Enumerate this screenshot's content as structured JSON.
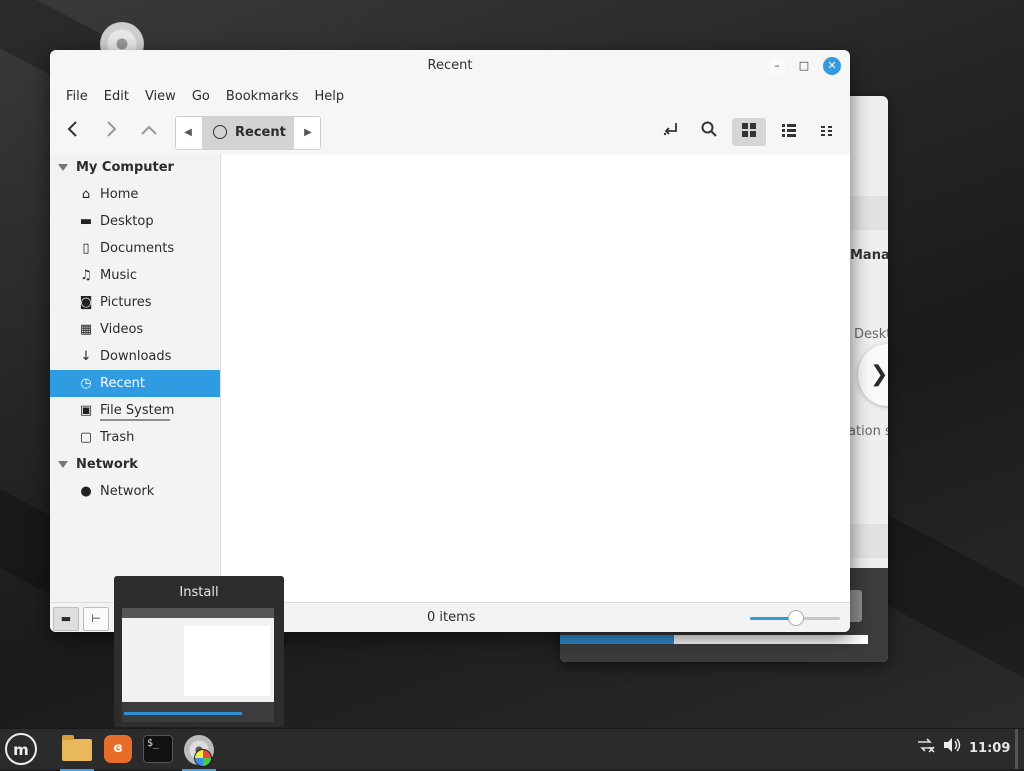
{
  "window": {
    "title": "Recent",
    "controls": {
      "minimize": "–",
      "maximize": "□",
      "close": "✕"
    }
  },
  "menubar": [
    "File",
    "Edit",
    "View",
    "Go",
    "Bookmarks",
    "Help"
  ],
  "toolbar": {
    "back_icon": "back-arrow-icon",
    "forward_icon": "forward-arrow-icon",
    "up_icon": "up-arrow-icon",
    "path_current": "Recent",
    "path_icon": "clock-icon",
    "view_mode_selected": "icon-view"
  },
  "sidebar": {
    "sections": [
      {
        "title": "My Computer",
        "items": [
          {
            "label": "Home",
            "icon": "home-icon",
            "glyph": "⌂"
          },
          {
            "label": "Desktop",
            "icon": "desktop-icon",
            "glyph": "▬"
          },
          {
            "label": "Documents",
            "icon": "document-icon",
            "glyph": "▯"
          },
          {
            "label": "Music",
            "icon": "music-icon",
            "glyph": "♫"
          },
          {
            "label": "Pictures",
            "icon": "camera-icon",
            "glyph": "◙"
          },
          {
            "label": "Videos",
            "icon": "film-icon",
            "glyph": "▦"
          },
          {
            "label": "Downloads",
            "icon": "download-icon",
            "glyph": "↓"
          },
          {
            "label": "Recent",
            "icon": "clock-icon",
            "glyph": "◷",
            "active": true
          },
          {
            "label": "File System",
            "icon": "drive-icon",
            "glyph": "▣"
          },
          {
            "label": "Trash",
            "icon": "trash-icon",
            "glyph": "▢"
          }
        ]
      },
      {
        "title": "Network",
        "items": [
          {
            "label": "Network",
            "icon": "globe-icon",
            "glyph": "●"
          }
        ]
      }
    ]
  },
  "statusbar": {
    "items_count": "0 items",
    "zoom_fraction": 0.5
  },
  "background_window": {
    "visible_text": [
      "Manag",
      "Deskto",
      "ation so"
    ],
    "progress_fraction": 0.37
  },
  "preview": {
    "title": "Install"
  },
  "taskbar": {
    "apps": [
      "menu-icon",
      "file-manager-icon",
      "firefox-icon",
      "terminal-icon",
      "installer-disc-icon"
    ],
    "terminal_text": "$_",
    "clock": "11:09",
    "accent": "#2f9be0"
  }
}
